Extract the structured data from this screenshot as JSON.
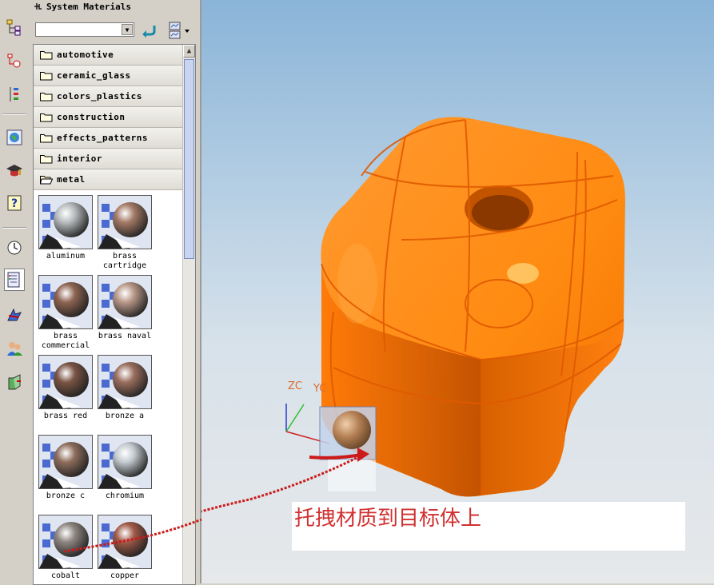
{
  "panel": {
    "title": "System Materials",
    "combo_value": "",
    "folders": [
      {
        "label": "automotive",
        "open": false
      },
      {
        "label": "ceramic_glass",
        "open": false
      },
      {
        "label": "colors_plastics",
        "open": false
      },
      {
        "label": "construction",
        "open": false
      },
      {
        "label": "effects_patterns",
        "open": false
      },
      {
        "label": "interior",
        "open": false
      },
      {
        "label": "metal",
        "open": true
      }
    ],
    "materials": [
      {
        "label": "aluminum",
        "color": "#b8bcbe"
      },
      {
        "label": "brass cartridge",
        "color": "#a47a66"
      },
      {
        "label": "brass commercial",
        "color": "#8e6452"
      },
      {
        "label": "brass naval",
        "color": "#b89888"
      },
      {
        "label": "brass red",
        "color": "#7a5444"
      },
      {
        "label": "bronze a",
        "color": "#9a6e5e"
      },
      {
        "label": "bronze c",
        "color": "#8e6e5c"
      },
      {
        "label": "chromium",
        "color": "#c4cad0"
      },
      {
        "label": "cobalt",
        "color": "#8e8680"
      },
      {
        "label": "copper",
        "color": "#a05a48"
      }
    ]
  },
  "toolbar_icons": [
    "assembly-navigator-icon",
    "part-navigator-icon",
    "constraint-navigator-icon",
    "web-browser-icon",
    "training-icon",
    "help-icon",
    "history-icon",
    "system-materials-icon",
    "process-studio-icon",
    "roles-icon",
    "reuse-library-icon"
  ],
  "viewport": {
    "axis_labels": [
      "ZC",
      "YC"
    ],
    "caption": "托拽材质到目标体上",
    "accent_color": "#f07a10"
  }
}
